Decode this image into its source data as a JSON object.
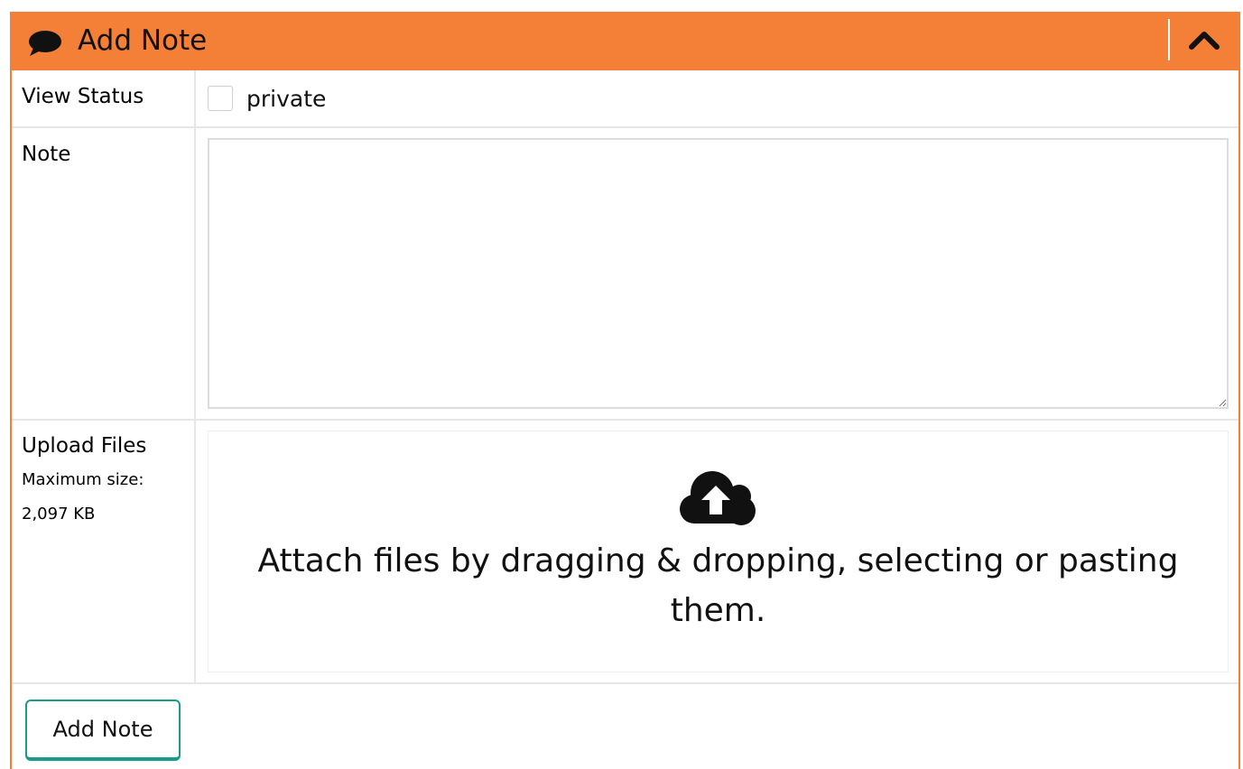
{
  "colors": {
    "header_bg": "#f47f36",
    "button_border": "#1a9a8a",
    "cell_border": "#e6e6e6"
  },
  "header": {
    "title": "Add Note",
    "icon": "comment-icon",
    "collapse_icon": "chevron-up-icon"
  },
  "form": {
    "view_status": {
      "label": "View Status",
      "checkbox_label": "private",
      "checked": false
    },
    "note": {
      "label": "Note",
      "value": ""
    },
    "upload": {
      "label": "Upload Files",
      "max_size_label": "Maximum size:",
      "max_size_value": "2,097 KB",
      "icon": "cloud-upload-icon",
      "drop_text": "Attach files by dragging & dropping, selecting or pasting them."
    }
  },
  "footer": {
    "submit_label": "Add Note"
  }
}
